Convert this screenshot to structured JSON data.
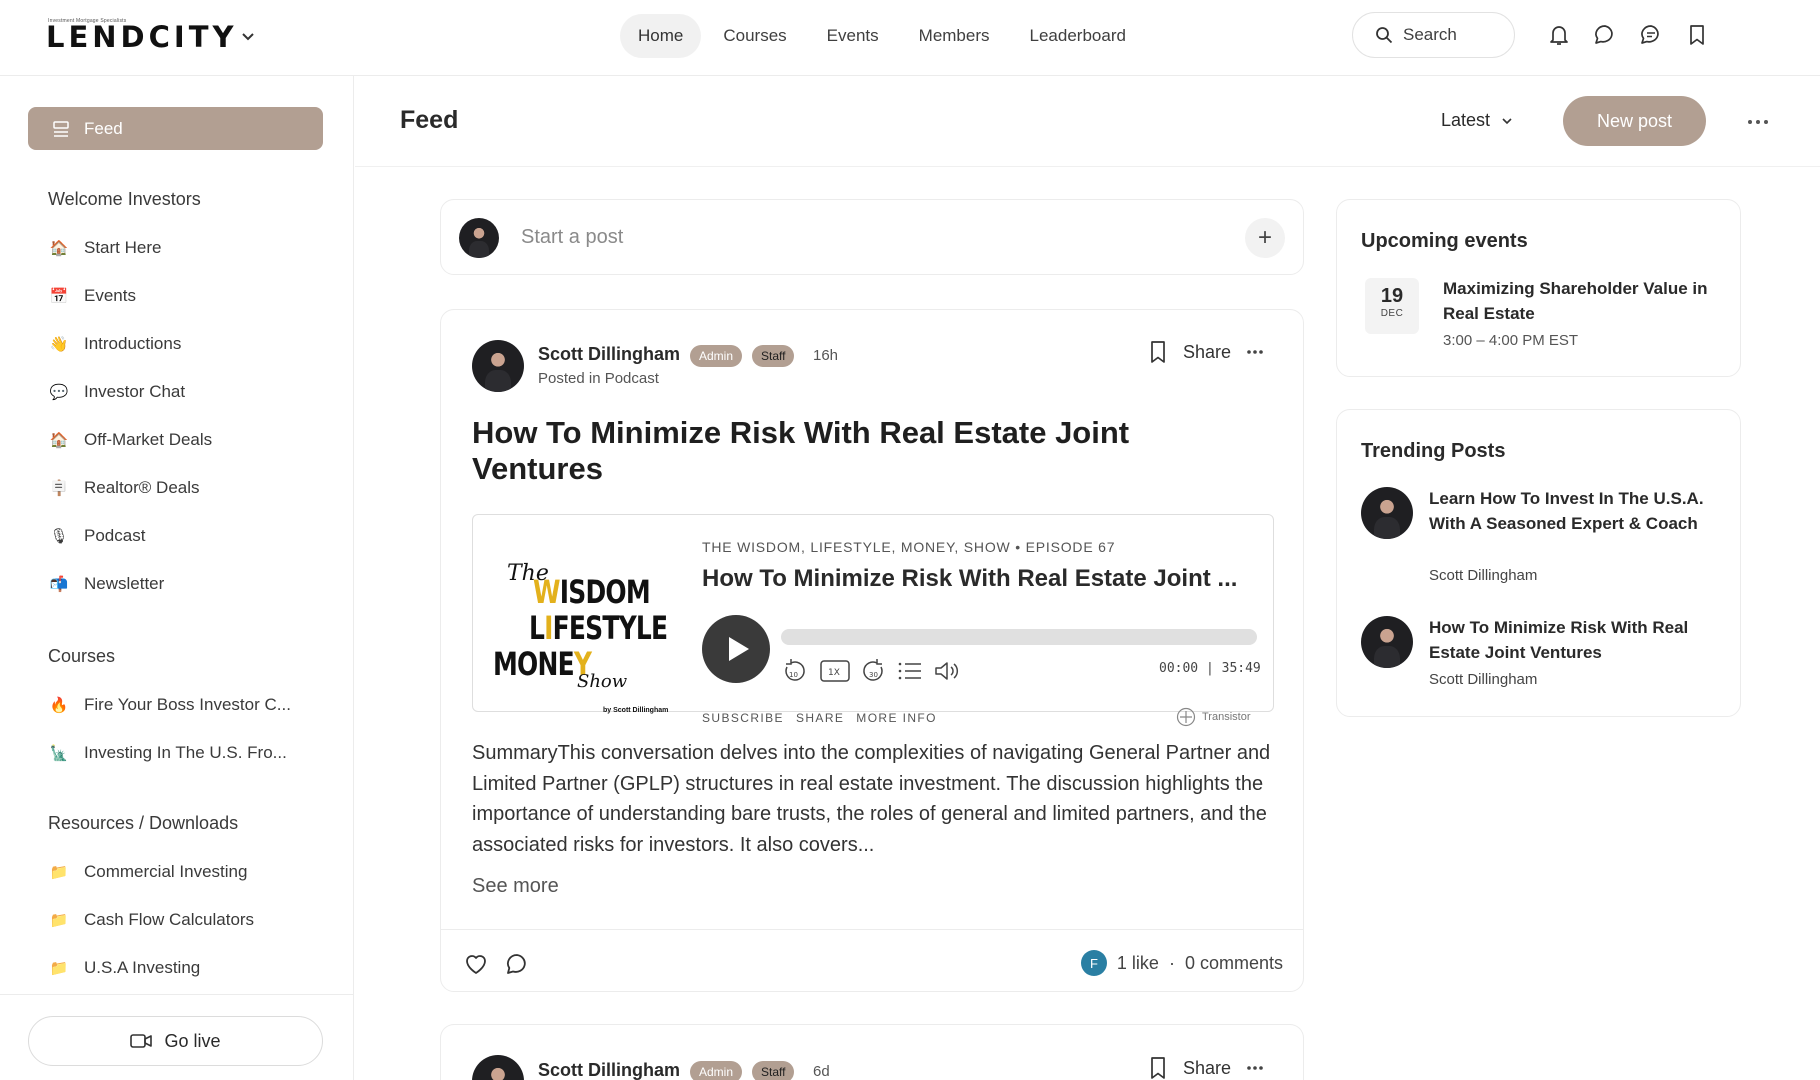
{
  "header": {
    "logo_text": "LENDCITY",
    "logo_superscript": "Investment Mortgage Specialists",
    "nav": [
      "Home",
      "Courses",
      "Events",
      "Members",
      "Leaderboard"
    ],
    "search_label": "Search"
  },
  "sidebar": {
    "feed_label": "Feed",
    "sections": [
      {
        "title": "Welcome Investors",
        "items": [
          {
            "emoji": "🏠",
            "label": "Start Here"
          },
          {
            "emoji": "📅",
            "label": "Events"
          },
          {
            "emoji": "👋",
            "label": "Introductions"
          },
          {
            "emoji": "💬",
            "label": "Investor Chat"
          },
          {
            "emoji": "🏠",
            "label": "Off-Market Deals"
          },
          {
            "emoji": "🪧",
            "label": "Realtor® Deals"
          },
          {
            "emoji": "🎙",
            "label": "Podcast"
          },
          {
            "emoji": "📬",
            "label": "Newsletter"
          }
        ]
      },
      {
        "title": "Courses",
        "items": [
          {
            "emoji": "🔥",
            "label": "Fire Your Boss Investor C..."
          },
          {
            "emoji": "🗽",
            "label": "Investing In The U.S. Fro..."
          }
        ]
      },
      {
        "title": "Resources / Downloads",
        "items": [
          {
            "emoji": "📁",
            "label": "Commercial Investing"
          },
          {
            "emoji": "📁",
            "label": "Cash Flow Calculators"
          },
          {
            "emoji": "📁",
            "label": "U.S.A Investing"
          }
        ]
      }
    ],
    "go_live_label": "Go live"
  },
  "feed": {
    "title": "Feed",
    "sort_label": "Latest",
    "new_post_label": "New post",
    "start_post_placeholder": "Start a post"
  },
  "post": {
    "author": "Scott Dillingham",
    "badge_admin": "Admin",
    "badge_staff": "Staff",
    "time": "16h",
    "posted_in": "Posted in Podcast",
    "share_label": "Share",
    "title": "How To Minimize Risk With Real Estate Joint Ventures",
    "player": {
      "cover_the": "The",
      "cover_line1_a": "W",
      "cover_line1_b": "ISDOM",
      "cover_line2_a": "L",
      "cover_line2_b": "I",
      "cover_line2_c": "FESTYLE",
      "cover_line3_a": "MONE",
      "cover_line3_b": "Y",
      "cover_show": "Show",
      "cover_by": "by Scott Dillingham",
      "episode_line": "THE WISDOM, LIFESTYLE, MONEY, SHOW",
      "episode_number": "EPISODE 67",
      "episode_title": "How To Minimize Risk With Real Estate Joint ...",
      "speed": "1X",
      "current_time": "00:00",
      "duration": "35:49",
      "links": [
        "SUBSCRIBE",
        "SHARE",
        "MORE INFO"
      ],
      "provider": "Transistor"
    },
    "summary": "SummaryThis conversation delves into the complexities of navigating General Partner and Limited Partner (GPLP) structures in real estate investment. The discussion highlights the importance of understanding bare trusts, the roles of general and limited partners, and the associated risks for investors. It also covers...",
    "see_more": "See more",
    "liker_initial": "F",
    "likes": "1 like",
    "comments": "0 comments"
  },
  "post2": {
    "author": "Scott Dillingham",
    "badge_admin": "Admin",
    "badge_staff": "Staff",
    "time": "6d",
    "share_label": "Share"
  },
  "upcoming_events": {
    "title": "Upcoming events",
    "items": [
      {
        "day": "19",
        "month": "DEC",
        "title": "Maximizing Shareholder Value in Real Estate",
        "time": "3:00 – 4:00 PM EST"
      }
    ]
  },
  "trending": {
    "title": "Trending Posts",
    "items": [
      {
        "title": "Learn How To Invest In The U.S.A. With A Seasoned Expert & Coach",
        "author": "Scott Dillingham"
      },
      {
        "title": "How To Minimize Risk With Real Estate Joint Ventures",
        "author": "Scott Dillingham"
      }
    ]
  }
}
